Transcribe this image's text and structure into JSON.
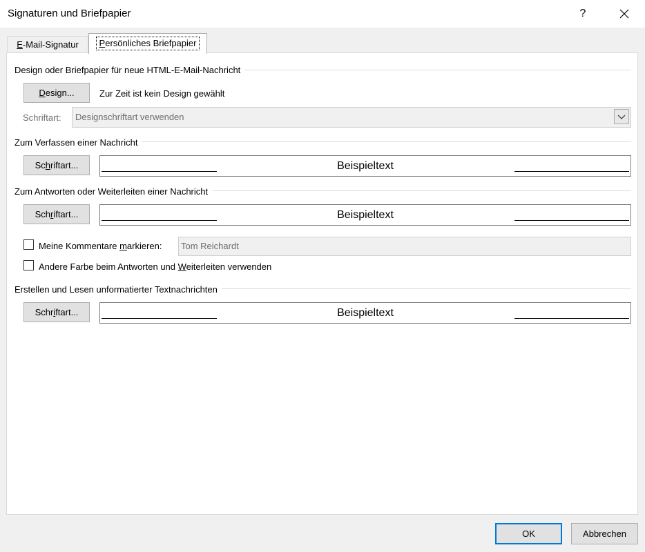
{
  "window": {
    "title": "Signaturen und Briefpapier",
    "help": "?"
  },
  "tabs": [
    {
      "label": "E-Mail-Signatur",
      "mnemonic": "E",
      "rest": "-Mail-Signatur"
    },
    {
      "label": "Persönliches Briefpapier",
      "mnemonic": "P",
      "rest": "ersönliches Briefpapier"
    }
  ],
  "design_group": {
    "title": "Design oder Briefpapier für neue HTML-E-Mail-Nachricht",
    "button_mnemonic": "D",
    "button_rest": "esign...",
    "status": "Zur Zeit ist kein Design gewählt",
    "font_label": "Schriftart:",
    "font_value": "Designschriftart verwenden"
  },
  "compose_group": {
    "title": "Zum Verfassen einer Nachricht",
    "button_pre": "Sc",
    "button_mnemonic": "h",
    "button_rest": "riftart...",
    "sample": "Beispieltext"
  },
  "reply_group": {
    "title": "Zum Antworten oder Weiterleiten einer Nachricht",
    "button_pre": "Sch",
    "button_mnemonic": "r",
    "button_rest": "iftart...",
    "sample": "Beispieltext",
    "mark_pre": "Meine Kommentare ",
    "mark_mnemonic": "m",
    "mark_rest": "arkieren:",
    "mark_value": "Tom Reichardt",
    "color_pre": "Andere Farbe beim Antworten und ",
    "color_mnemonic": "W",
    "color_rest": "eiterleiten verwenden"
  },
  "plain_group": {
    "title": "Erstellen und Lesen unformatierter Textnachrichten",
    "button_pre": "Schr",
    "button_mnemonic": "i",
    "button_rest": "ftart...",
    "sample": "Beispieltext"
  },
  "footer": {
    "ok": "OK",
    "cancel": "Abbrechen"
  }
}
